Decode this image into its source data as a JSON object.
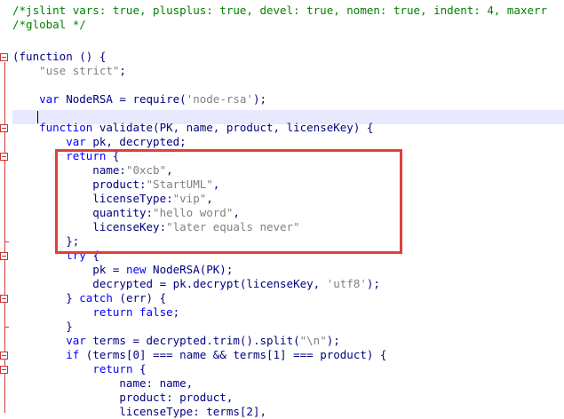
{
  "code_lines": [
    {
      "parts": [
        {
          "t": "/*jslint vars: true, plusplus: true, devel: true, nomen: true, indent: 4, maxerr",
          "c": "cmt"
        }
      ]
    },
    {
      "parts": [
        {
          "t": "/*global */",
          "c": "cmt"
        }
      ]
    },
    {
      "parts": [
        {
          "t": "",
          "c": "plain"
        }
      ]
    },
    {
      "parts": [
        {
          "t": "(function () {",
          "c": "plain"
        }
      ]
    },
    {
      "parts": [
        {
          "t": "    ",
          "c": "plain"
        },
        {
          "t": "\"use strict\"",
          "c": "str"
        },
        {
          "t": ";",
          "c": "plain"
        }
      ]
    },
    {
      "parts": [
        {
          "t": "",
          "c": "plain"
        }
      ]
    },
    {
      "parts": [
        {
          "t": "    ",
          "c": "plain"
        },
        {
          "t": "var",
          "c": "kw"
        },
        {
          "t": " NodeRSA = require(",
          "c": "plain"
        },
        {
          "t": "'node-rsa'",
          "c": "str"
        },
        {
          "t": ");",
          "c": "plain"
        }
      ]
    },
    {
      "parts": [
        {
          "t": "",
          "c": "plain"
        }
      ]
    },
    {
      "parts": [
        {
          "t": "    ",
          "c": "plain"
        },
        {
          "t": "function",
          "c": "kw"
        },
        {
          "t": " validate(PK, name, product, licenseKey) {",
          "c": "plain"
        }
      ]
    },
    {
      "parts": [
        {
          "t": "        ",
          "c": "plain"
        },
        {
          "t": "var",
          "c": "kw"
        },
        {
          "t": " pk, decrypted;",
          "c": "plain"
        }
      ]
    },
    {
      "parts": [
        {
          "t": "        ",
          "c": "plain"
        },
        {
          "t": "return",
          "c": "kw"
        },
        {
          "t": " {",
          "c": "plain"
        }
      ]
    },
    {
      "parts": [
        {
          "t": "            name:",
          "c": "plain"
        },
        {
          "t": "\"0xcb\"",
          "c": "str"
        },
        {
          "t": ",",
          "c": "plain"
        }
      ]
    },
    {
      "parts": [
        {
          "t": "            product:",
          "c": "plain"
        },
        {
          "t": "\"StartUML\"",
          "c": "str"
        },
        {
          "t": ",",
          "c": "plain"
        }
      ]
    },
    {
      "parts": [
        {
          "t": "            licenseType:",
          "c": "plain"
        },
        {
          "t": "\"vip\"",
          "c": "str"
        },
        {
          "t": ",",
          "c": "plain"
        }
      ]
    },
    {
      "parts": [
        {
          "t": "            quantity:",
          "c": "plain"
        },
        {
          "t": "\"hello word\"",
          "c": "str"
        },
        {
          "t": ",",
          "c": "plain"
        }
      ]
    },
    {
      "parts": [
        {
          "t": "            licenseKey:",
          "c": "plain"
        },
        {
          "t": "\"later equals never\"",
          "c": "str"
        }
      ]
    },
    {
      "parts": [
        {
          "t": "        };",
          "c": "plain"
        }
      ]
    },
    {
      "parts": [
        {
          "t": "        ",
          "c": "plain"
        },
        {
          "t": "try",
          "c": "kw"
        },
        {
          "t": " {",
          "c": "plain"
        }
      ]
    },
    {
      "parts": [
        {
          "t": "            pk = ",
          "c": "plain"
        },
        {
          "t": "new",
          "c": "kw"
        },
        {
          "t": " NodeRSA(PK);",
          "c": "plain"
        }
      ]
    },
    {
      "parts": [
        {
          "t": "            decrypted = pk.decrypt(licenseKey, ",
          "c": "plain"
        },
        {
          "t": "'utf8'",
          "c": "str"
        },
        {
          "t": ");",
          "c": "plain"
        }
      ]
    },
    {
      "parts": [
        {
          "t": "        } ",
          "c": "plain"
        },
        {
          "t": "catch",
          "c": "kw"
        },
        {
          "t": " (err) {",
          "c": "plain"
        }
      ]
    },
    {
      "parts": [
        {
          "t": "            ",
          "c": "plain"
        },
        {
          "t": "return",
          "c": "kw"
        },
        {
          "t": " ",
          "c": "plain"
        },
        {
          "t": "false",
          "c": "kw"
        },
        {
          "t": ";",
          "c": "plain"
        }
      ]
    },
    {
      "parts": [
        {
          "t": "        }",
          "c": "plain"
        }
      ]
    },
    {
      "parts": [
        {
          "t": "        ",
          "c": "plain"
        },
        {
          "t": "var",
          "c": "kw"
        },
        {
          "t": " terms = decrypted.trim().split(",
          "c": "plain"
        },
        {
          "t": "\"\\n\"",
          "c": "str"
        },
        {
          "t": ");",
          "c": "plain"
        }
      ]
    },
    {
      "parts": [
        {
          "t": "        ",
          "c": "plain"
        },
        {
          "t": "if",
          "c": "kw"
        },
        {
          "t": " (terms[0] === name && terms[1] === product) {",
          "c": "plain"
        }
      ]
    },
    {
      "parts": [
        {
          "t": "            ",
          "c": "plain"
        },
        {
          "t": "return",
          "c": "kw"
        },
        {
          "t": " {",
          "c": "plain"
        }
      ]
    },
    {
      "parts": [
        {
          "t": "                name: name,",
          "c": "plain"
        }
      ]
    },
    {
      "parts": [
        {
          "t": "                product: product,",
          "c": "plain"
        }
      ]
    },
    {
      "parts": [
        {
          "t": "                licenseType: terms[2],",
          "c": "plain"
        }
      ]
    }
  ]
}
